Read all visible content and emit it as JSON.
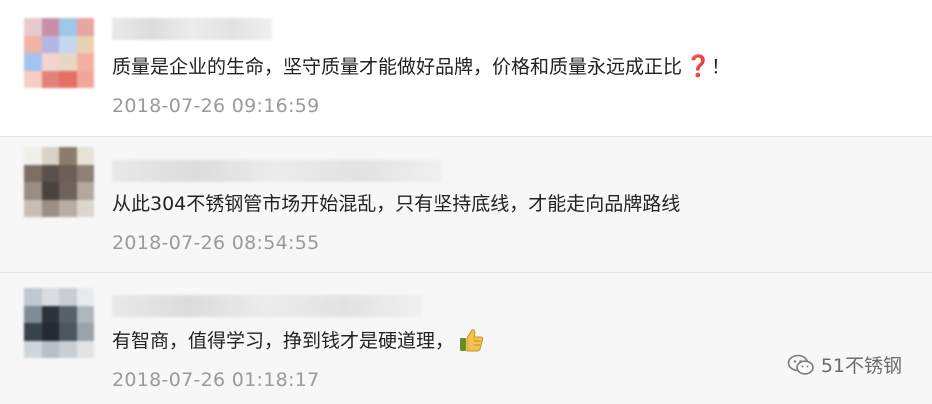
{
  "comments": [
    {
      "text": "质量是企业的生命，坚守质量才能做好品牌，价格和质量永远成正比",
      "trailing": "！",
      "emoji": "question-mark-emoji",
      "time": "2018-07-26 09:16:59",
      "avatar_colors": [
        "#e7c9d0",
        "#c98fa6",
        "#9ec7e8",
        "#e7a6a1",
        "#f0b3a6",
        "#b4b6e6",
        "#c2d8f0",
        "#ead1b0",
        "#a2c4ef",
        "#f2d4cc",
        "#e9d7c6",
        "#f3b0a1",
        "#f6cfc4",
        "#e2837a",
        "#e36f65",
        "#f0a79a"
      ]
    },
    {
      "text": "从此304不锈钢管市场开始混乱，只有坚持底线，才能走向品牌路线",
      "time": "2018-07-26 08:54:55",
      "avatar_colors": [
        "#f1efe9",
        "#d9d3c7",
        "#8b7d6d",
        "#e8e2d8",
        "#7c6f64",
        "#5b514a",
        "#6b5f56",
        "#8d8177",
        "#9a8d82",
        "#4a423c",
        "#6e625a",
        "#b3a89d",
        "#c8beb3",
        "#9b8f84",
        "#b7ada2",
        "#ddd6cc"
      ]
    },
    {
      "text": "有智商，值得学习，挣到钱才是硬道理，",
      "emoji": "thumbs-up-emoji",
      "time": "2018-07-26 01:18:17",
      "avatar_colors": [
        "#bfc9cf",
        "#d8dde0",
        "#c6ced3",
        "#e7ebed",
        "#7f8d96",
        "#2b3438",
        "#566168",
        "#aeb7bc",
        "#39434a",
        "#232b30",
        "#4b565d",
        "#99a3a9",
        "#cfd6da",
        "#b7c0c5",
        "#c8cfd3",
        "#e0e4e6"
      ]
    }
  ],
  "watermark": {
    "label": "51不锈钢",
    "icon": "wechat-icon"
  }
}
